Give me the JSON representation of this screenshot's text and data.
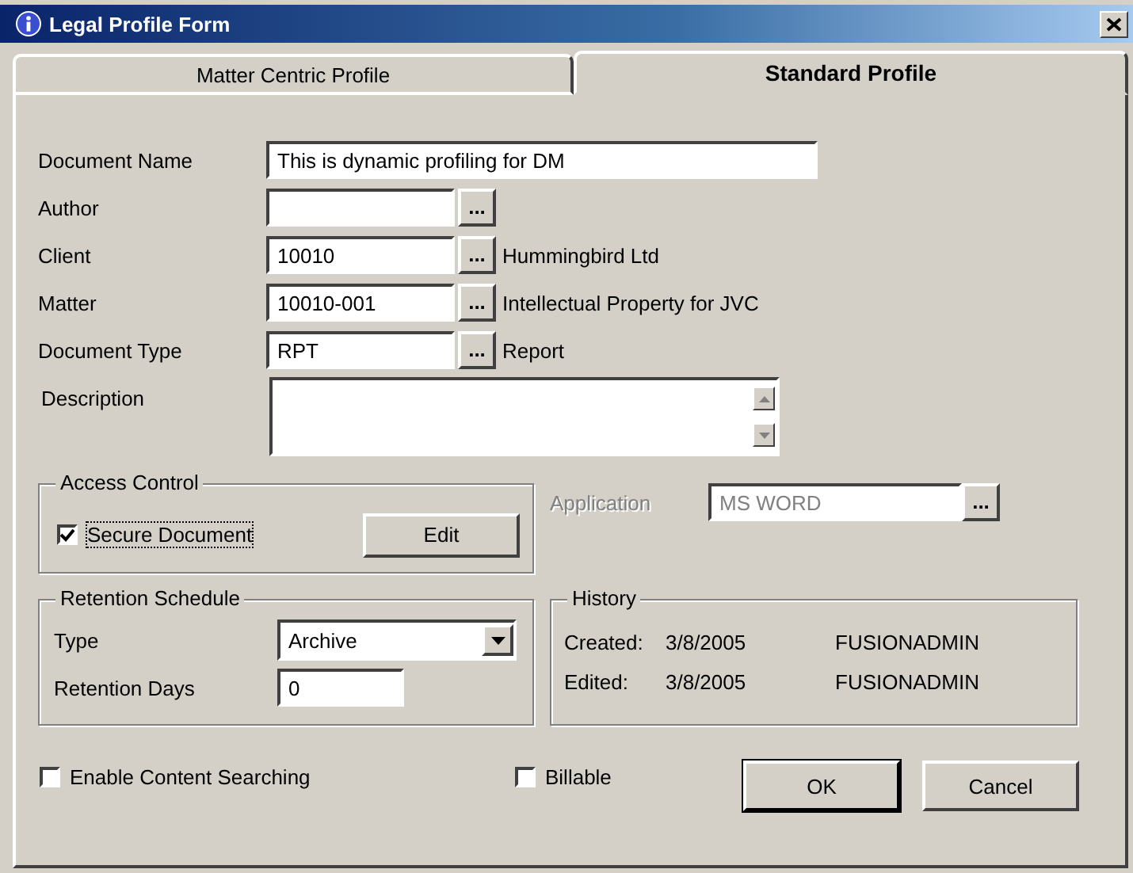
{
  "window": {
    "title": "Legal Profile Form"
  },
  "tabs": [
    {
      "label": "Matter Centric Profile",
      "selected": false
    },
    {
      "label": "Standard Profile",
      "selected": true
    }
  ],
  "fields": [
    {
      "kind": "wide",
      "label": "Document Name",
      "value": "This is dynamic profiling for DM"
    },
    {
      "kind": "lookup",
      "label": "Author",
      "button": "..."
    },
    {
      "kind": "lookup",
      "label": "Client",
      "value": "10010",
      "button": "...",
      "detail": "Hummingbird Ltd"
    },
    {
      "kind": "lookup",
      "label": "Matter",
      "value": "10010-001",
      "button": "...",
      "detail": "Intellectual Property for JVC"
    },
    {
      "kind": "lookup",
      "label": "Document Type",
      "value": "RPT",
      "button": "...",
      "detail": "Report"
    },
    {
      "kind": "memo",
      "label": "Description"
    }
  ],
  "access_control": {
    "title": "Access Control",
    "secure": {
      "label": "Secure Document",
      "checked": true
    },
    "edit_button": "Edit"
  },
  "application": {
    "label": "Application",
    "value": "MS WORD",
    "button": "...",
    "disabled": true
  },
  "retention": {
    "title": "Retention Schedule",
    "type_label": "Type",
    "type_value": "Archive",
    "days_label": "Retention Days",
    "days_value": "0"
  },
  "history": {
    "title": "History",
    "rows": [
      {
        "label": "Created:",
        "date": "3/8/2005",
        "user": "FUSIONADMIN"
      },
      {
        "label": "Edited:",
        "date": "3/8/2005",
        "user": "FUSIONADMIN"
      }
    ]
  },
  "options": [
    {
      "label": "Enable Content Searching",
      "checked": false
    },
    {
      "label": "Billable",
      "checked": false
    }
  ],
  "buttons": [
    "OK",
    "Cancel"
  ]
}
